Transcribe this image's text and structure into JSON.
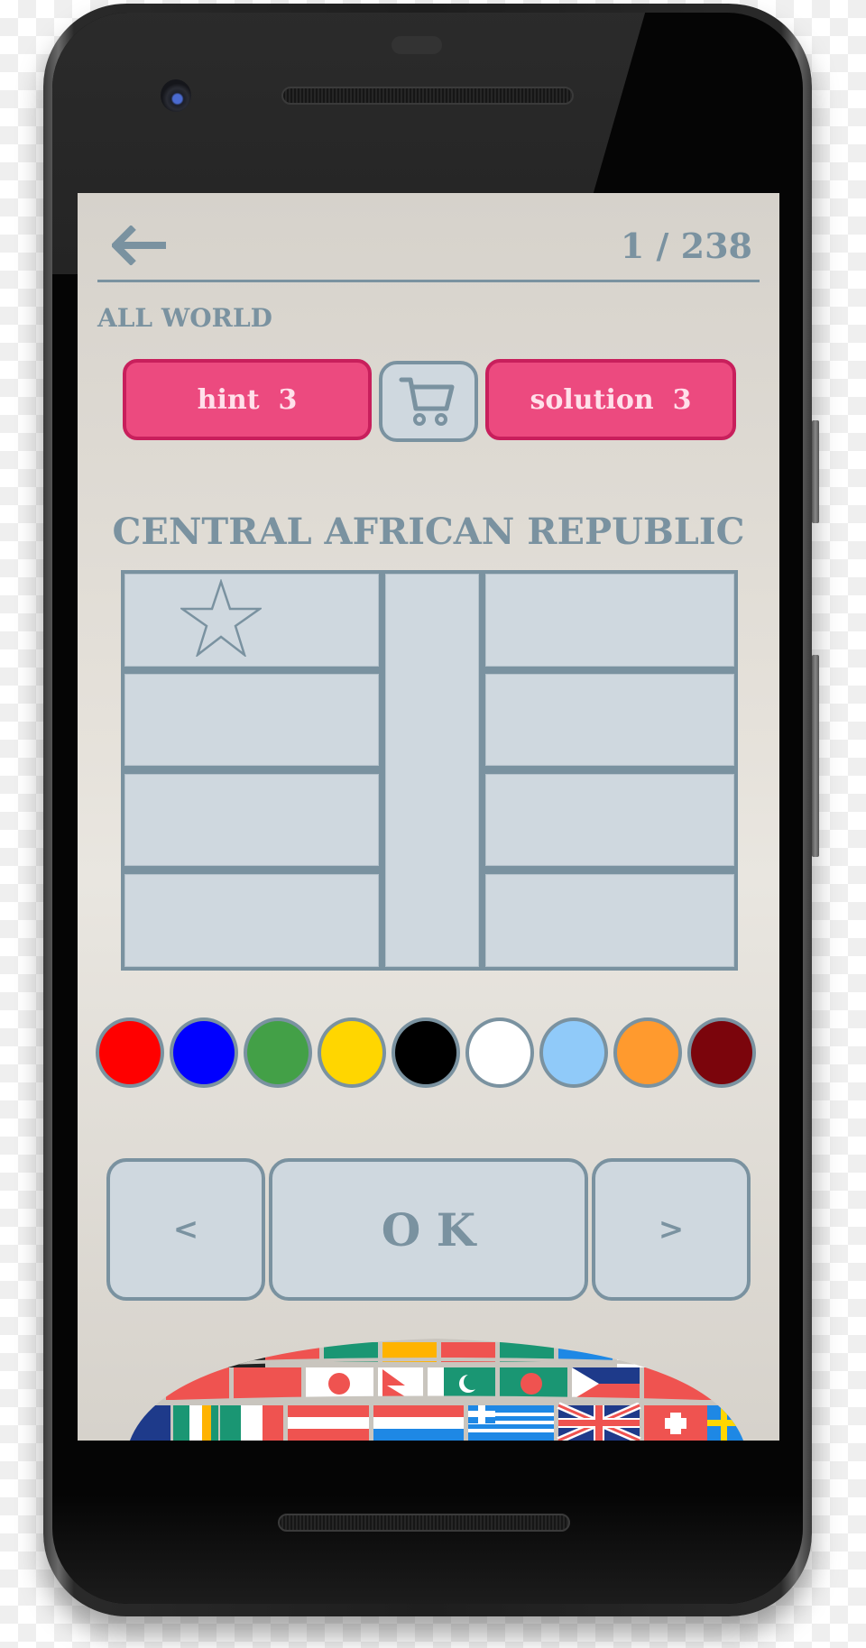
{
  "header": {
    "back_icon": "arrow-left-icon",
    "progress_counter": "1 / 238"
  },
  "category": "ALL WORLD",
  "actions": {
    "hint_label": "hint  3",
    "cart_icon": "shopping-cart-icon",
    "solution_label": "solution  3"
  },
  "puzzle": {
    "country_name": "CENTRAL AFRICAN REPUBLIC",
    "flag_outline_color": "#7a92a0",
    "flag_fill_color": "#cfd8df",
    "star_icon": "star-outline-icon",
    "regions": [
      "stripe-left-1",
      "stripe-left-2",
      "stripe-left-3",
      "stripe-left-4",
      "center-band",
      "stripe-right-1",
      "stripe-right-2",
      "stripe-right-3",
      "stripe-right-4"
    ]
  },
  "palette": [
    {
      "name": "red",
      "color": "#ff0000"
    },
    {
      "name": "blue",
      "color": "#0000ff"
    },
    {
      "name": "green",
      "color": "#43a047"
    },
    {
      "name": "yellow",
      "color": "#ffd600"
    },
    {
      "name": "black",
      "color": "#000000"
    },
    {
      "name": "white",
      "color": "#ffffff"
    },
    {
      "name": "light-blue",
      "color": "#90caf9"
    },
    {
      "name": "orange",
      "color": "#ff9a2e"
    },
    {
      "name": "maroon",
      "color": "#7b050c"
    }
  ],
  "navigation": {
    "prev_label": "<",
    "ok_label": "O K",
    "next_label": ">"
  },
  "theme": {
    "accent_pink": "#ec4a7f",
    "accent_pink_border": "#c81f5c",
    "slate": "#7a92a0",
    "panel": "#cfd8df"
  }
}
